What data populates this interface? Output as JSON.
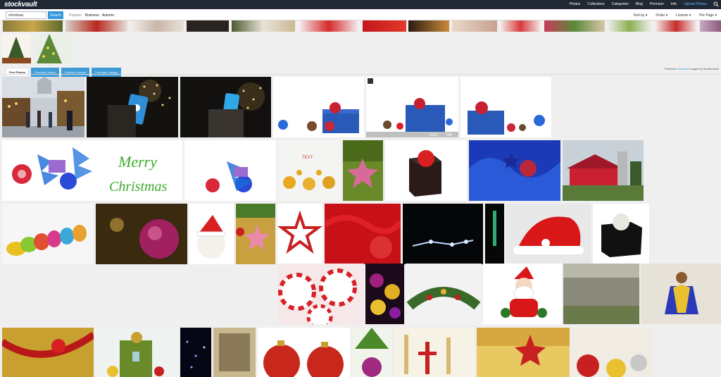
{
  "topbar": {
    "logo": "stockvault",
    "nav": [
      "Photos",
      "Collections",
      "Categories",
      "Blog",
      "Premium",
      "Info"
    ],
    "upload_label": "Upload Photos"
  },
  "search": {
    "value": "christmas",
    "button_label": "Search",
    "popular_label": "Popular:",
    "popular_links": [
      "Business",
      "Autumn"
    ]
  },
  "filters": {
    "sort_by": "Sort by",
    "order": "Order",
    "license": "License",
    "per_page": "Per Page"
  },
  "tabs": [
    "Free Photos",
    "Premium Photos",
    "Premium Vectors",
    "Premium Footage"
  ],
  "premium_note": {
    "prefix": "Premium",
    "keyword": "christmas",
    "suffix": "images by Shutterstock"
  },
  "badge_text": {
    "views": "5293",
    "likes": "505"
  },
  "merry": {
    "line1": "Merry",
    "line2": "Christmas"
  },
  "colors": {
    "topbar": "#1f2833",
    "accent": "#3498db",
    "upload_link": "#6ab8ff"
  }
}
